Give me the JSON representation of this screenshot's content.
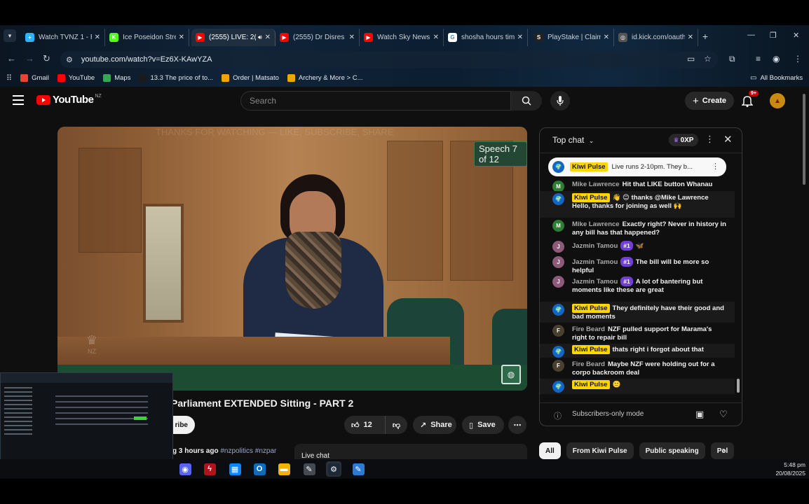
{
  "browser": {
    "tabs": [
      {
        "title": "Watch TVNZ 1 - F",
        "fav_color": "#2bb3ff",
        "fav_glyph": "+",
        "active": false
      },
      {
        "title": "Ice Poseidon Stre",
        "fav_color": "#53fc18",
        "fav_glyph": "K",
        "active": false
      },
      {
        "title": "(2555) LIVE: 2(",
        "fav_color": "#ff0000",
        "fav_glyph": "▶",
        "active": true
      },
      {
        "title": "(2555) Dr Disres",
        "fav_color": "#ff0000",
        "fav_glyph": "▶",
        "active": false
      },
      {
        "title": "Watch Sky News",
        "fav_color": "#ff0000",
        "fav_glyph": "▶",
        "active": false
      },
      {
        "title": "shosha hours tim",
        "fav_color": "#ffffff",
        "fav_glyph": "G",
        "active": false
      },
      {
        "title": "PlayStake | Claim",
        "fav_color": "#222222",
        "fav_glyph": "S",
        "active": false
      },
      {
        "title": "id.kick.com/oauth",
        "fav_color": "#555555",
        "fav_glyph": "◎",
        "active": false
      }
    ],
    "url": "youtube.com/watch?v=Ez6X-KAwYZA",
    "bookmarks": [
      {
        "label": "Gmail",
        "color": "#ea4335"
      },
      {
        "label": "YouTube",
        "color": "#ff0000"
      },
      {
        "label": "Maps",
        "color": "#34a853"
      },
      {
        "label": "13.3 The price of to...",
        "color": "#1a1a1a"
      },
      {
        "label": "Order | Matsato",
        "color": "#f0a400"
      },
      {
        "label": "Archery & More > C...",
        "color": "#f0a400"
      }
    ],
    "all_bookmarks": "All Bookmarks"
  },
  "yt": {
    "logo": "YouTube",
    "country": "NZ",
    "search_placeholder": "Search",
    "create_label": "Create",
    "notif_count": "9+",
    "video": {
      "speech_badge": "Speech 7 of 12",
      "watermark": "THANKS FOR WATCHING — LIKE, SUBSCRIBE, SHARE",
      "crest_text": "NZ"
    },
    "title": "Parliament EXTENDED Sitting - PART 2",
    "subscribe_label": "ribe",
    "like_count": "12",
    "share_label": "Share",
    "save_label": "Save",
    "meta_time": "g 3 hours ago",
    "meta_tags": "#nzpolitics #nzpar",
    "live_chat_label": "Live chat",
    "chips": [
      "All",
      "From Kiwi Pulse",
      "Public speaking",
      "Pol"
    ]
  },
  "chat": {
    "header": "Top chat",
    "xp": "0XP",
    "pinned": {
      "author": "Kiwi Pulse",
      "text": "Live runs 2-10pm. They b..."
    },
    "messages": [
      {
        "author": "Mike Lawrence",
        "owner": false,
        "badge": "",
        "text": "Hit that LIKE button Whanau",
        "avatar_color": "#2e7d32",
        "avatar_glyph": "M",
        "hl": false
      },
      {
        "author": "Kiwi Pulse",
        "owner": true,
        "badge": "",
        "text": "👋 😊 thanks @Mike Lawrence Hello, thanks for joining as well 🙌",
        "avatar_color": "#1565c0",
        "avatar_glyph": "🌍",
        "hl": true
      },
      {
        "author": "Mike Lawrence",
        "owner": false,
        "badge": "",
        "text": "Exactly right? Never in history in any bill has that happened?",
        "avatar_color": "#2e7d32",
        "avatar_glyph": "M",
        "hl": false
      },
      {
        "author": "Jazmin Tamou",
        "owner": false,
        "badge": "#1",
        "text": "🦋",
        "avatar_color": "#8e5a7a",
        "avatar_glyph": "J",
        "hl": false
      },
      {
        "author": "Jazmin Tamou",
        "owner": false,
        "badge": "#1",
        "text": "The bill will be more so helpful",
        "avatar_color": "#8e5a7a",
        "avatar_glyph": "J",
        "hl": false
      },
      {
        "author": "Jazmin Tamou",
        "owner": false,
        "badge": "#1",
        "text": "A lot of bantering but moments like these are great",
        "avatar_color": "#8e5a7a",
        "avatar_glyph": "J",
        "hl": false
      },
      {
        "author": "Kiwi Pulse",
        "owner": true,
        "badge": "",
        "text": "They definitely have their good and bad moments",
        "avatar_color": "#1565c0",
        "avatar_glyph": "🌍",
        "hl": true
      },
      {
        "author": "Fire Beard",
        "owner": false,
        "badge": "",
        "text": "NZF pulled support for Marama's right to repair bill",
        "avatar_color": "#4a4030",
        "avatar_glyph": "F",
        "hl": false
      },
      {
        "author": "Kiwi Pulse",
        "owner": true,
        "badge": "",
        "text": "thats right i forgot about that",
        "avatar_color": "#1565c0",
        "avatar_glyph": "🌍",
        "hl": true
      },
      {
        "author": "Fire Beard",
        "owner": false,
        "badge": "",
        "text": "Maybe NZF were holding out for a corpo backroom deal",
        "avatar_color": "#4a4030",
        "avatar_glyph": "F",
        "hl": false
      },
      {
        "author": "Kiwi Pulse",
        "owner": true,
        "badge": "",
        "text": "🙂",
        "avatar_color": "#1565c0",
        "avatar_glyph": "🌍",
        "hl": true
      }
    ],
    "footer": "Subscribers-only mode"
  },
  "taskbar": {
    "time": "5:48 pm",
    "date": "20/08/2025",
    "apps": [
      {
        "name": "discord-icon",
        "color": "#5865f2",
        "glyph": "◉"
      },
      {
        "name": "lightning-app-icon",
        "color": "#b3121b",
        "glyph": "ϟ"
      },
      {
        "name": "store-icon",
        "color": "#0a84ff",
        "glyph": "▦"
      },
      {
        "name": "outlook-icon",
        "color": "#0f6cbd",
        "glyph": "O"
      },
      {
        "name": "file-explorer-icon",
        "color": "#f2b300",
        "glyph": "▬"
      },
      {
        "name": "app-icon",
        "color": "#444a52",
        "glyph": "✎"
      },
      {
        "name": "steam-icon",
        "color": "#1b2838",
        "glyph": "⚙"
      },
      {
        "name": "paint-icon",
        "color": "#2a7bd6",
        "glyph": "✎"
      }
    ]
  }
}
